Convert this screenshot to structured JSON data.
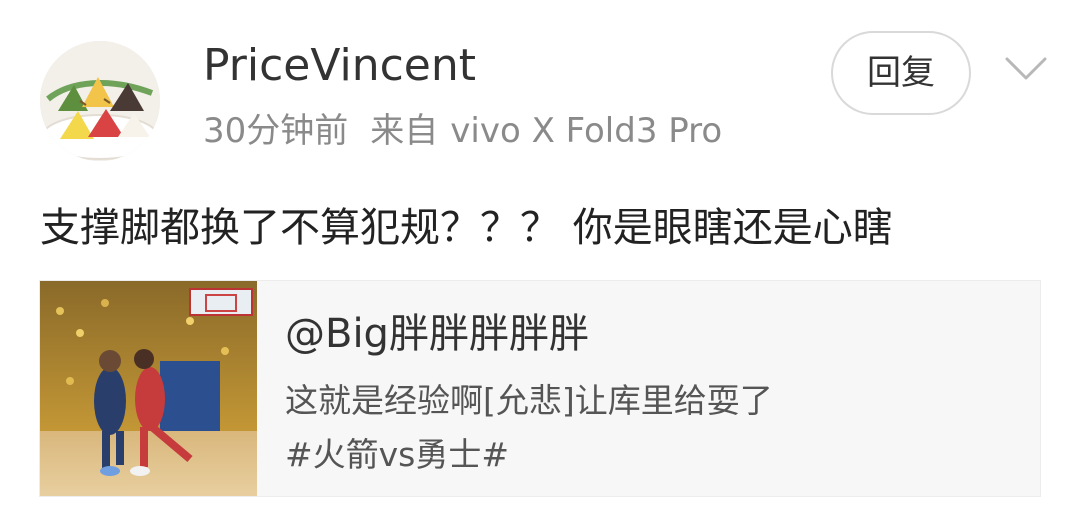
{
  "post": {
    "username": "PriceVincent",
    "time": "30分钟前",
    "source_prefix": "来自",
    "device": "vivo X Fold3 Pro",
    "reply_label": "回复",
    "comment": "支撑脚都换了不算犯规？？？ 你是眼瞎还是心瞎"
  },
  "quoted": {
    "author": "@Big胖胖胖胖胖",
    "text": "这就是经验啊[允悲]让库里给耍了",
    "hashtag": "#火箭vs勇士#"
  },
  "icons": {
    "expand": "chevron-down-icon"
  },
  "colors": {
    "username": "#333333",
    "meta": "#8a8a8a",
    "comment": "#222222",
    "card_background": "#f7f7f7",
    "button_border": "#d9d9d9"
  }
}
